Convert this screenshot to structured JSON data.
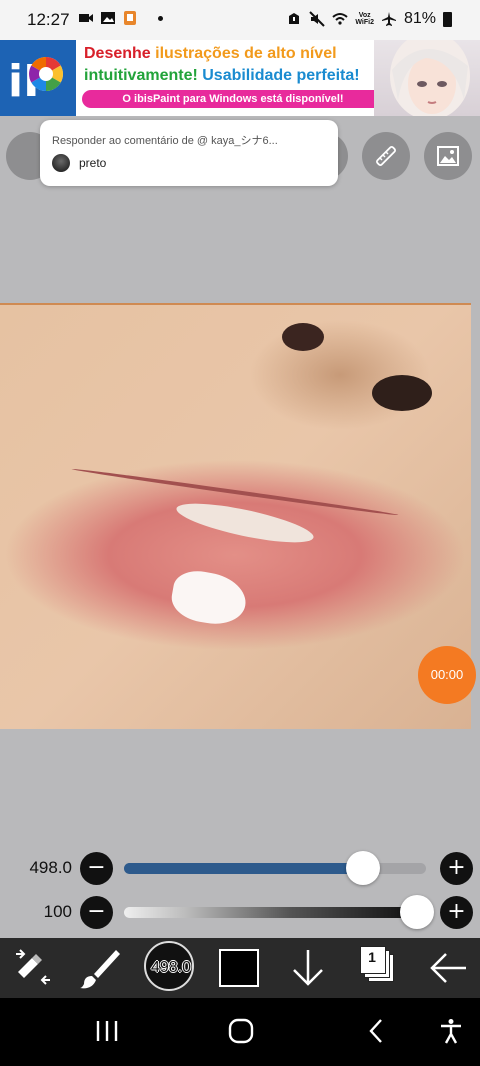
{
  "status_bar": {
    "time": "12:27",
    "network_label": "Voz\nWiFi2",
    "battery": "81%",
    "icons": [
      "video-icon",
      "image-icon",
      "app-icon",
      "dot",
      "alarm-icon",
      "mute-icon",
      "wifi-icon",
      "airplane-icon",
      "battery-icon"
    ]
  },
  "ad": {
    "logo": "iP",
    "line1_a": "Desenhe ",
    "line1_b": "ilustrações de alto nível",
    "line2_a": "intuitivamente! ",
    "line2_b": "Usabilidade perfeita!",
    "pill": "O ibisPaint para Windows está disponível!"
  },
  "reply": {
    "title": "Responder ao comentário de @ kaya_シナ6...",
    "text": "preto"
  },
  "timer": "00:00",
  "sliders": {
    "size": {
      "value": "498.0",
      "fill": 0.82
    },
    "opacity": {
      "value": "100",
      "fill": 1.0
    }
  },
  "bottom_toolbar": {
    "brush_size": "498.0",
    "layer_count": "1"
  },
  "colors": {
    "accent": "#2d5a8c",
    "timer": "#f47a22",
    "ad_pink": "#e82a9c"
  }
}
